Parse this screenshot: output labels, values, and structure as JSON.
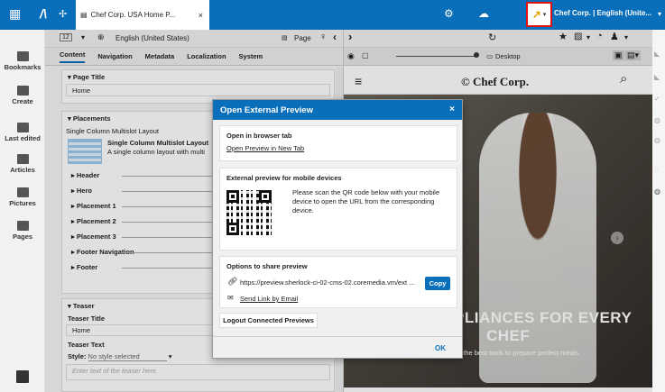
{
  "topbar": {
    "tab_title": "Chef Corp. USA Home P...",
    "user_info": "admin | Chef Corp. | English (Unite..."
  },
  "leftnav": {
    "items": [
      "Bookmarks",
      "Create",
      "Last edited",
      "Articles",
      "Pictures",
      "Pages"
    ]
  },
  "editor": {
    "language": "English (United States)",
    "page_label": "Page",
    "tabs": [
      "Content",
      "Navigation",
      "Metadata",
      "Localization",
      "System"
    ],
    "page_title_label": "Page Title",
    "page_title_value": "Home",
    "placements_label": "Placements",
    "layout_name": "Single Column Multislot Layout",
    "layout_title": "Single Column Multislot Layout",
    "layout_desc": "A single column layout with multi",
    "placements": [
      "Header",
      "Hero",
      "Placement 1",
      "Placement 2",
      "Placement 3",
      "Footer Navigation",
      "Footer"
    ],
    "teaser_label": "Teaser",
    "teaser_title_label": "Teaser Title",
    "teaser_title_value": "Home",
    "teaser_text_label": "Teaser Text",
    "style_label": "Style:",
    "style_value": "No style selected",
    "teaser_placeholder": "Enter text of the teaser here."
  },
  "preview": {
    "device_label": "Desktop",
    "brand": "Chef Corp.",
    "hero_title": "PLIANCES FOR EVERY",
    "hero_title2": "CHEF",
    "hero_sub": "h the best tools to prepare perfect meals."
  },
  "dialog": {
    "title": "Open External Preview",
    "browser_tab_title": "Open in browser tab",
    "browser_tab_link": "Open Preview in New Tab",
    "mobile_title": "External preview for mobile devices",
    "mobile_text": "Please scan the QR code below with your mobile device to open the URL from the corresponding device.",
    "share_title": "Options to share preview",
    "share_url": "https://preview.sherlock-ci-02-cms-02.coremedia.vm/ext ...",
    "copy_label": "Copy",
    "email_link": "Send Link by Email",
    "logout_label": "Logout Connected Previews",
    "ok_label": "OK"
  }
}
